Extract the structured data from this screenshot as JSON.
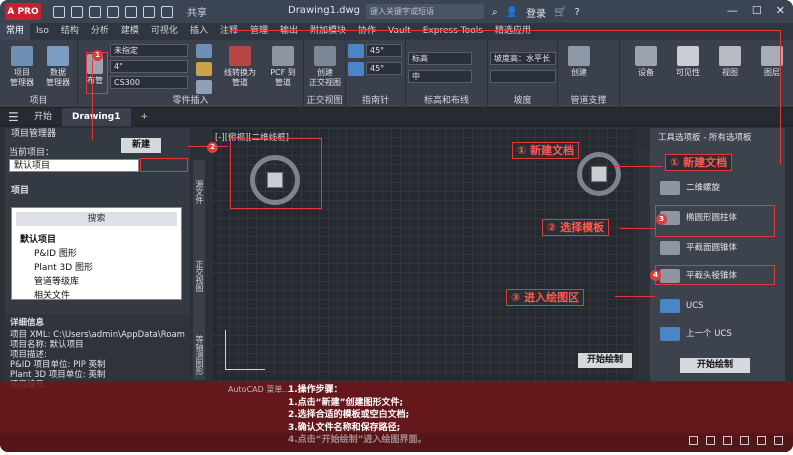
{
  "titlebar": {
    "logo": "A PRO",
    "share": "共享",
    "doc_title": "Drawing1.dwg",
    "search_placeholder": "键入关键字或短语",
    "login": "登录",
    "help": "?"
  },
  "ribbon_tabs": [
    "常用",
    "Iso",
    "结构",
    "分析",
    "建模",
    "可视化",
    "插入",
    "注释",
    "管理",
    "输出",
    "附加模块",
    "协作",
    "Vault",
    "Express Tools",
    "精选应用"
  ],
  "ribbon": {
    "project_group": {
      "label": "项目",
      "btn1": "项目\n管理器",
      "btn2": "数据\n管理器"
    },
    "parts_group": {
      "label": "零件插入",
      "btn_layout": "布管",
      "field1": "未指定",
      "field2": "4\"",
      "field3": "CS300",
      "btn_convert": "线转换为\n管道",
      "btn_pcf": "PCF 到\n管道"
    },
    "ortho_group": {
      "label": "正交视图",
      "btn_create": "创建\n正交视图"
    },
    "compass_group": {
      "label": "指南针",
      "angle1": "45°",
      "angle2": "45°"
    },
    "tag_group": {
      "label": "标高和布线",
      "field1": "标高",
      "field2": "中"
    },
    "slope_group": {
      "label": "坡度",
      "field1": "坡度高：水平长",
      "field2": ""
    },
    "support_group": {
      "label": "管道支撑",
      "btn_create": "创建"
    },
    "right_buttons": [
      "设备",
      "可见性",
      "视图",
      "图层"
    ]
  },
  "doc_tabs": {
    "start": "开始",
    "drawing": "Drawing1",
    "add": "+"
  },
  "project_manager": {
    "title": "项目管理器",
    "current_project_label": "当前项目：",
    "current_project": "默认项目",
    "project_label": "项目",
    "search": "搜索",
    "tree": [
      "默认项目",
      "P&ID 图形",
      "Plant 3D 图形",
      "管道等级库",
      "相关文件"
    ],
    "side_tab": "源文件",
    "side_tab2": "正交视图",
    "side_tab3": "等轴测图形",
    "details_title": "详细信息",
    "details": [
      "项目 XML: C:\\Users\\admin\\AppData\\Roam",
      "项目名称: 默认项目",
      "项目描述:",
      "P&ID 项目单位: PIP 英制",
      "Plant 3D 项目单位: 英制",
      "项目编号:"
    ]
  },
  "canvas": {
    "view_label": "[-][俯视][二维线框]"
  },
  "tool_palette": {
    "title": "工具选项板 - 所有选项板",
    "items": [
      "二维螺旋",
      "椭圆形圆柱体",
      "平截面圆锥体",
      "平截头棱锥体",
      "UCS",
      "上一个 UCS",
      "开始绘制"
    ]
  },
  "annotations": {
    "new_button": "新建",
    "new_doc_left": "① 新建文档",
    "new_doc_right": "① 新建文档",
    "choose_template": "② 选择模板",
    "enter_drawing": "③ 进入绘图区",
    "start_drawing_left": "开始绘制",
    "start_drawing_right": "开始绘制",
    "badge1": "1",
    "badge2": "2",
    "badge3": "3",
    "badge4": "4"
  },
  "instructions": {
    "title": "1.操作步骤：",
    "step1": "1.点击“新建”创建图形文件;",
    "step2": "2.选择合适的模板或空白文档;",
    "step3": "3.确认文件名称和保存路径;",
    "step4": "4.点击“开始绘制”进入绘图界面。"
  },
  "command_line": "AutoCAD 菜单...",
  "colors": {
    "accent_red": "#e03a3a",
    "overlay": "#6e1418",
    "canvas": "#262a30"
  }
}
